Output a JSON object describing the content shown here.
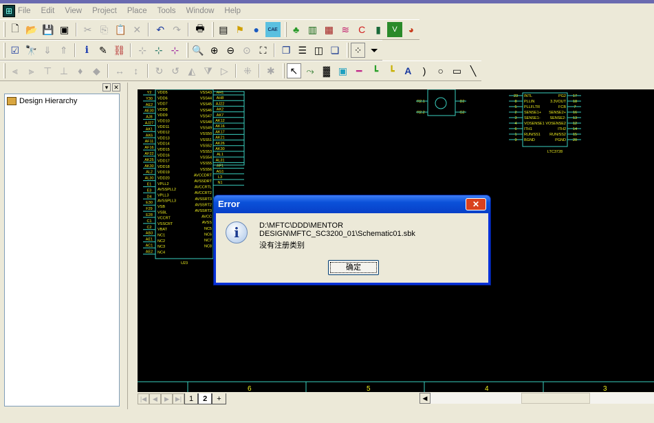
{
  "menu": [
    "File",
    "Edit",
    "View",
    "Project",
    "Place",
    "Tools",
    "Window",
    "Help"
  ],
  "panel": {
    "tree_item": "Design Hierarchy"
  },
  "sheet_tabs": [
    "1",
    "2",
    "+"
  ],
  "zone_labels": [
    "6",
    "5",
    "4",
    "3"
  ],
  "dialog": {
    "title": "Error",
    "path": "D:\\MFTC\\DDD\\MENTOR DESIGN\\MFTC_SC3200_01\\Schematic01.sbk",
    "message": "没有注册类别",
    "ok_label": "确定"
  },
  "schematic": {
    "u1_left_pins": [
      "Y2",
      "Y30",
      "AE2",
      "AE30",
      "AJ8",
      "AJ27",
      "AK1",
      "AK6",
      "AF11",
      "AF16",
      "AF22",
      "AK25",
      "AK30",
      "AL2",
      "AL30",
      "E1",
      "E3",
      "D4",
      "E30",
      "F29",
      "E28",
      "C1",
      "C2",
      "AB3",
      "AE1",
      "AC1",
      "AE2"
    ],
    "u1_left_names": [
      "VDD5",
      "VDD6",
      "VDD7",
      "VDD8",
      "VDD9",
      "VDD10",
      "VDD11",
      "VDD12",
      "VDD13",
      "VDD14",
      "VDD15",
      "VDD16",
      "VDD17",
      "VDD18",
      "VDD19",
      "VDD20",
      "VPLL2",
      "AVSSPLL2",
      "VPLL3",
      "AVSSPLL3",
      "VSB",
      "VSBL",
      "VCCRT",
      "VSSCRT",
      "VBAT",
      "NC1",
      "NC2",
      "NC3",
      "NC4"
    ],
    "u1_right_names": [
      "VSS43",
      "VSS44",
      "VSS45",
      "VSS46",
      "VSS47",
      "VSS48",
      "VSS49",
      "VSS50",
      "VSS51",
      "VSS52",
      "VSS53",
      "VSS54",
      "VSS55",
      "VSS56",
      "AVCCDRT",
      "AVSSDRT",
      "AVCCRTL",
      "AVCCRT2",
      "AVSSRT3",
      "AVSSRT2",
      "AVSSRT3",
      "AVCC",
      "AVSS",
      "NC5",
      "NC6",
      "NC7",
      "NC8"
    ],
    "u1_right_pins": [
      "AH1",
      "AH8",
      "AJ22",
      "AK2",
      "AK7",
      "AK12",
      "AK16",
      "AK17",
      "AK21",
      "AK26",
      "AK30",
      "AL1",
      "AL31",
      "AF1",
      "AG1",
      "L3",
      "N1"
    ],
    "u1_ref": "U23",
    "u2_left_pins": [
      "23",
      "8",
      "5",
      "2",
      "3",
      "4",
      "6",
      "1",
      "9"
    ],
    "u2_left_names": [
      "INTL",
      "PLLIN",
      "PLLFLTR",
      "SENSE1+",
      "SENSE1-",
      "VOSENSE1",
      "ITH1",
      "RUN/SS1",
      "BGND"
    ],
    "u2_right_names": [
      "PG2",
      "3.3VOUT",
      "FCB",
      "SENSE2+",
      "SENSE2-",
      "VOSENSE2",
      "ITH2",
      "RUN/SS2",
      "PGND"
    ],
    "u2_right_pins": [
      "17",
      "18",
      "7",
      "16",
      "13",
      "12",
      "14",
      "15",
      "20"
    ],
    "u2_ref": "LTC3728",
    "q_pins": [
      "R2.1",
      "R2.2",
      "D2",
      "G2"
    ]
  }
}
